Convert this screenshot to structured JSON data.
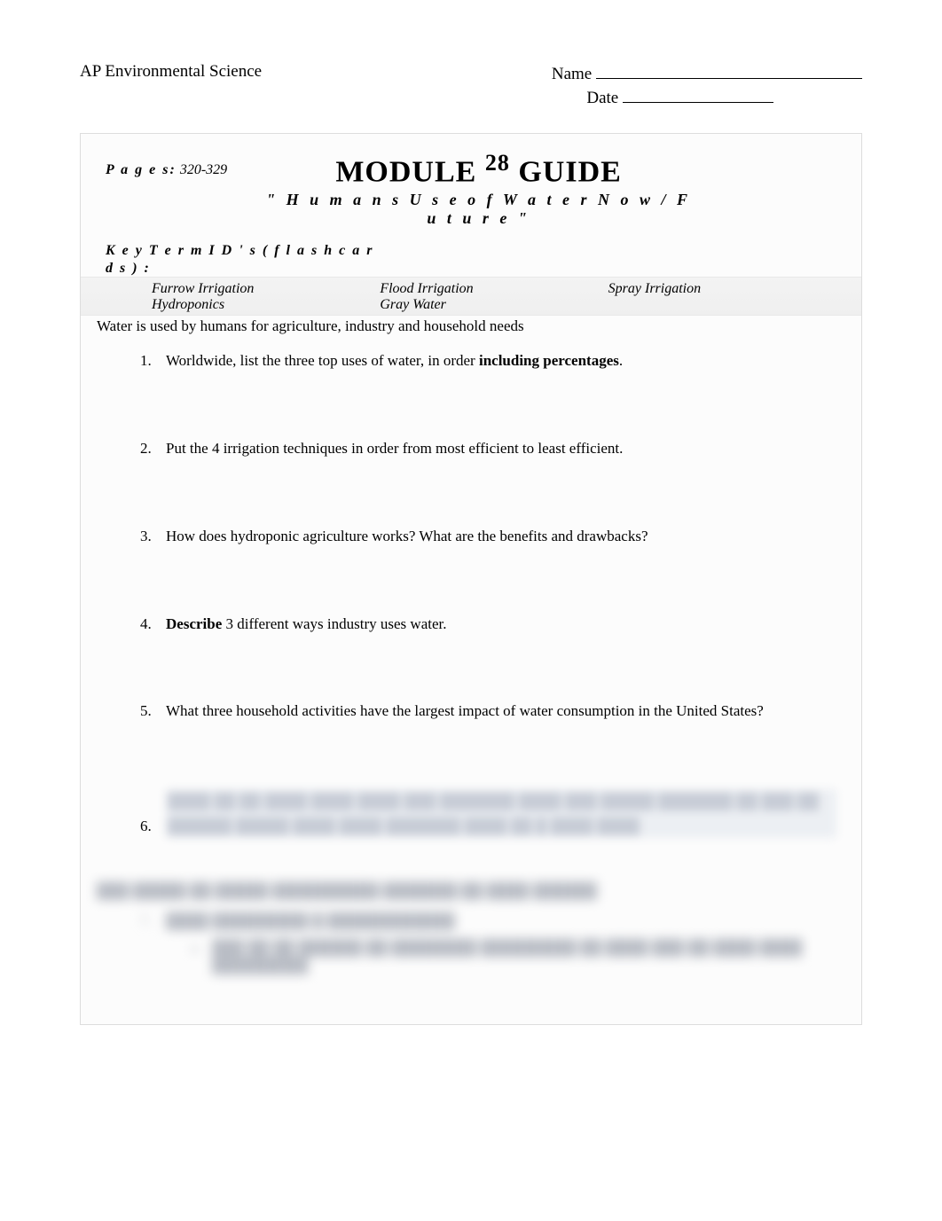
{
  "header": {
    "course": "AP Environmental Science",
    "name_label": "Name",
    "date_label": "Date"
  },
  "module": {
    "pages_label": "P a g e s:",
    "pages_value": "320-329",
    "title_prefix": "MODULE ",
    "title_number": "28",
    "title_suffix": " GUIDE",
    "subtitle": "\" H u m a n s  U s e  o f  W a t e r  N o w / F u t u r e \""
  },
  "keyterms": {
    "label_line1": "K e y  T e r m  I D ' s ( f l a s h c a r",
    "label_line2": "d s ) :",
    "terms": [
      [
        "Furrow Irrigation",
        "Flood Irrigation",
        "Spray Irrigation"
      ],
      [
        "Hydroponics",
        "Gray Water",
        ""
      ]
    ]
  },
  "intro": "Water is used by humans for agriculture, industry and household needs",
  "questions": [
    {
      "pre": "Worldwide, list the three top uses of water, in order ",
      "bold": "including percentages",
      "post": "."
    },
    {
      "pre": "Put the 4 irrigation techniques in order from most efficient to least efficient.",
      "bold": "",
      "post": ""
    },
    {
      "pre": "How does hydroponic agriculture works? What are the benefits and drawbacks?",
      "bold": "",
      "post": ""
    },
    {
      "pre": "",
      "bold": "Describe",
      "post": " 3 different ways industry uses water."
    },
    {
      "pre": "What three household activities have the largest impact of water consumption in the United States?",
      "bold": "",
      "post": ""
    }
  ],
  "q6_blur": "████ ██ ██ ████ ████ ████ ███ ███████ ████  ███ █████ ███████ ██ ███ ██ ██████ █████ ████ ████\n███████ ████ ██ █ ████ ████",
  "section2": {
    "heading_blur": "███ █████ ██ █████ ██████████ ███████ ██ ████ ██████",
    "q7_blur": "████ █████████ █ ████████████",
    "q7a_blur": "███ ██ ██ ██████ ██ ████████ █████████ ██ ████ ███ ██ ████ ████ █████████"
  }
}
